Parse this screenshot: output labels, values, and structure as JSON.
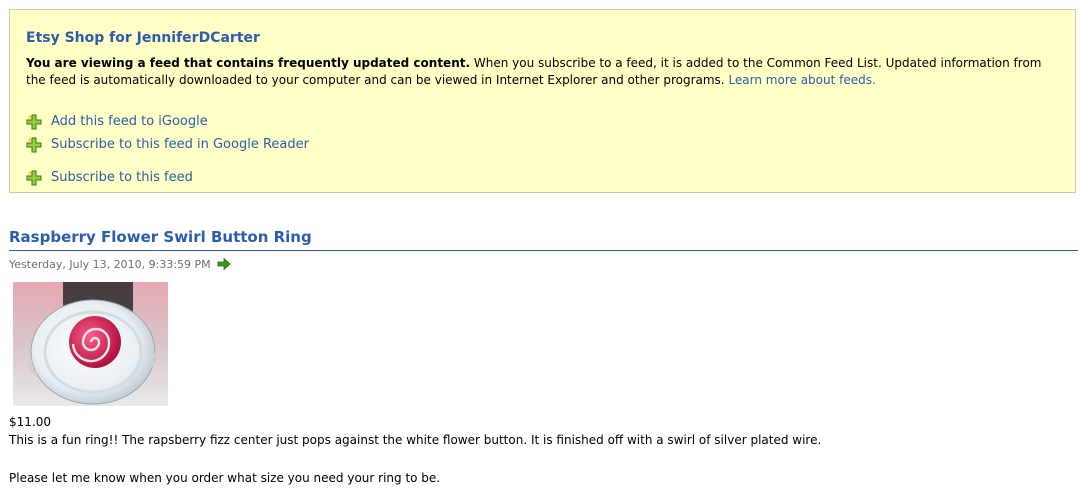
{
  "feed": {
    "title": "Etsy Shop for JenniferDCarter",
    "notice_bold": "You are viewing a feed that contains frequently updated content.",
    "notice_text": " When you subscribe to a feed, it is added to the Common Feed List. Updated information from the feed is automatically downloaded to your computer and can be viewed in Internet Explorer and other programs. ",
    "learn_more": "Learn more about feeds.",
    "subscribe_options": [
      {
        "label": "Add this feed to iGoogle",
        "icon": "add-plus-icon"
      },
      {
        "label": "Subscribe to this feed in Google Reader",
        "icon": "add-plus-icon"
      },
      {
        "label": "Subscribe to this feed",
        "icon": "add-plus-icon"
      }
    ]
  },
  "item": {
    "title": "Raspberry Flower Swirl Button Ring",
    "date": "Yesterday, July 13, 2010, 9:33:59 PM",
    "go_icon": "green-arrow-icon",
    "image_alt": "ring photo",
    "price": "$11.00",
    "description": "This is a fun ring!! The rapsberry fizz center just pops against the white flower button. It is finished off with a swirl of silver plated wire.",
    "note": "Please let me know when you order what size you need your ring to be."
  },
  "colors": {
    "accent": "#2a5db0",
    "feed_bg": "#ffffc6",
    "meta_text": "#6e6e6e"
  }
}
